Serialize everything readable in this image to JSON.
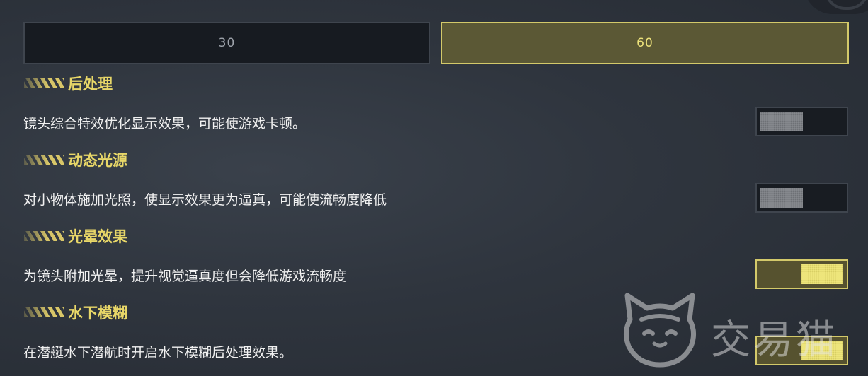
{
  "fps": {
    "options": [
      "30",
      "60"
    ],
    "selected": "60"
  },
  "sections": [
    {
      "title": "后处理",
      "description": "镜头综合特效优化显示效果，可能使游戏卡顿。",
      "enabled": false
    },
    {
      "title": "动态光源",
      "description": "对小物体施加光照，使显示效果更为逼真，可能使流畅度降低",
      "enabled": false
    },
    {
      "title": "光晕效果",
      "description": "为镜头附加光晕，提升视觉逼真度但会降低游戏流畅度",
      "enabled": true
    },
    {
      "title": "水下模糊",
      "description": "在潜艇水下潜航时开启水下模糊后处理效果。",
      "enabled": true
    }
  ],
  "watermark": {
    "text": "交易猫",
    "icon": "cat-logo-icon"
  },
  "colors": {
    "accent": "#e8d768",
    "selected_fill": "#5b5835",
    "selected_border": "#d3c96a",
    "background": "#2f353e"
  }
}
